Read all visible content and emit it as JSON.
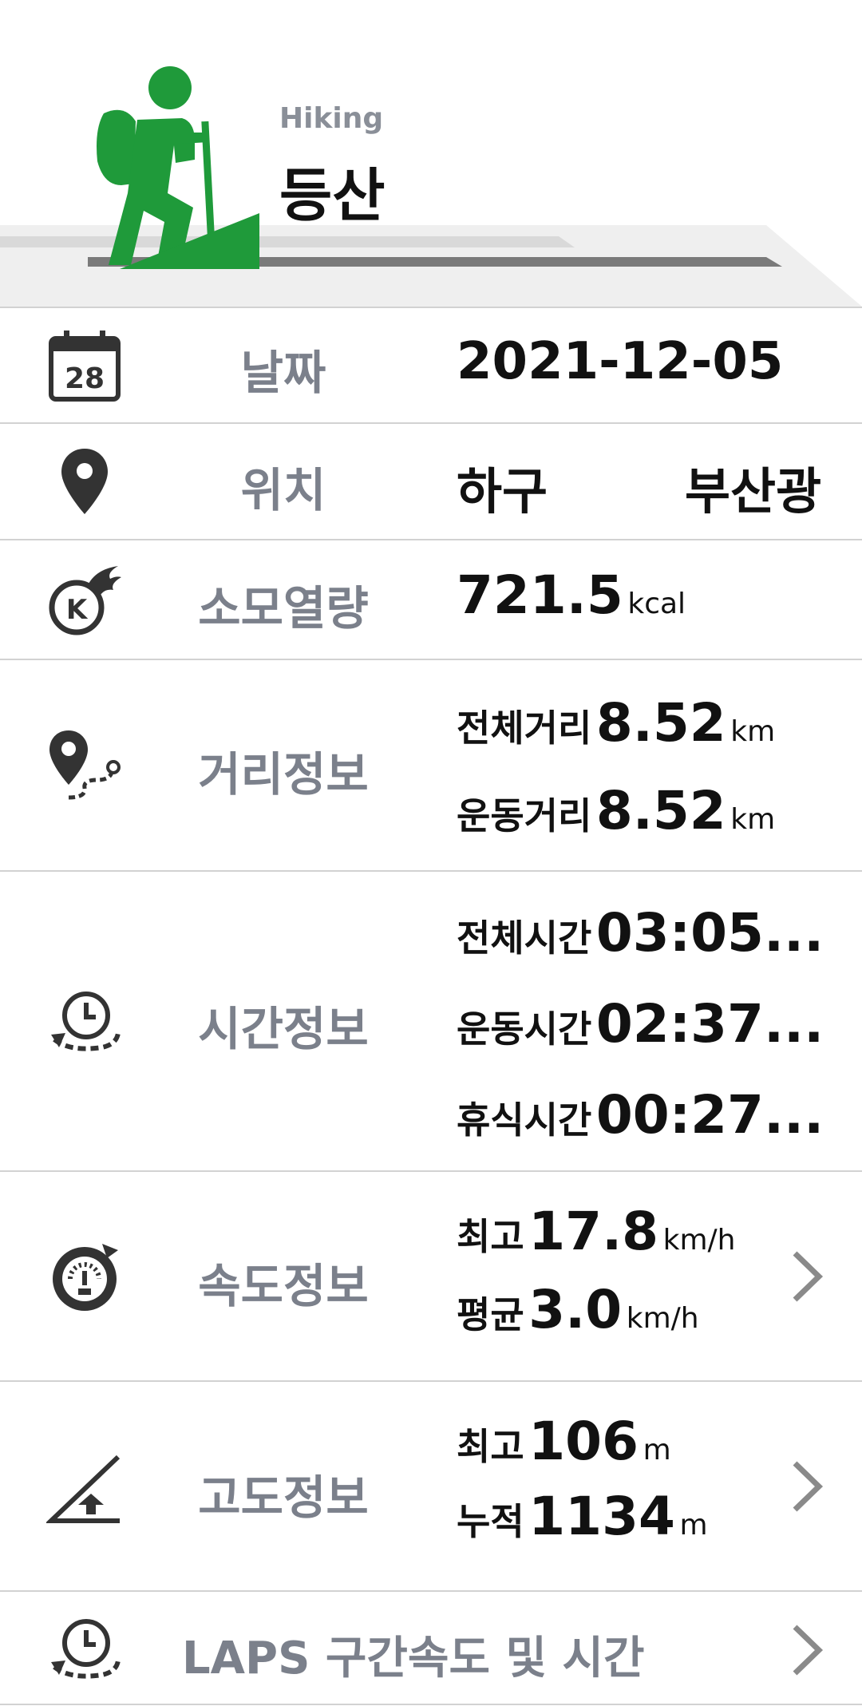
{
  "header": {
    "subtitle": "Hiking",
    "title": "등산",
    "accent": "#1f9a3a"
  },
  "date": {
    "label": "날짜",
    "value": "2021-12-05",
    "icon": "calendar-icon",
    "day": "28"
  },
  "location": {
    "label": "위치",
    "value_left": "하구",
    "value_right": "부산광",
    "icon": "location-pin-icon"
  },
  "calories": {
    "label": "소모열량",
    "value": "721.5",
    "unit": "kcal",
    "icon": "calorie-fire-icon",
    "badge": "K"
  },
  "distance": {
    "label": "거리정보",
    "icon": "route-pin-icon",
    "items": [
      {
        "key": "전체거리",
        "value": "8.52",
        "unit": "km"
      },
      {
        "key": "운동거리",
        "value": "8.52",
        "unit": "km"
      }
    ]
  },
  "time": {
    "label": "시간정보",
    "icon": "clock-loop-icon",
    "items": [
      {
        "key": "전체시간",
        "value": "03:05..."
      },
      {
        "key": "운동시간",
        "value": "02:37..."
      },
      {
        "key": "휴식시간",
        "value": "00:27..."
      }
    ]
  },
  "speed": {
    "label": "속도정보",
    "icon": "speedometer-icon",
    "items": [
      {
        "key": "최고",
        "value": "17.8",
        "unit": "km/h"
      },
      {
        "key": "평균",
        "value": "3.0",
        "unit": "km/h"
      }
    ]
  },
  "altitude": {
    "label": "고도정보",
    "icon": "altitude-slope-icon",
    "items": [
      {
        "key": "최고",
        "value": "106",
        "unit": "m"
      },
      {
        "key": "누적",
        "value": "1134",
        "unit": "m"
      }
    ]
  },
  "laps": {
    "label": "LAPS 구간속도 및 시간",
    "icon": "lap-clock-icon"
  }
}
